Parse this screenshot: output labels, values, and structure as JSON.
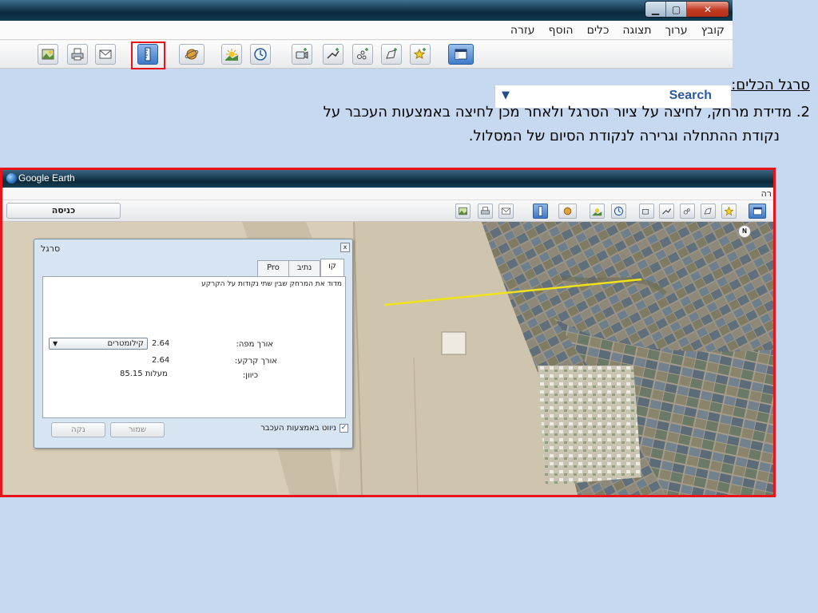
{
  "window_controls": {
    "minimize": "▁",
    "maximize": "▢",
    "close": "✕"
  },
  "menubar": {
    "items": [
      "קובץ",
      "ערוך",
      "תצוגה",
      "כלים",
      "הוסף",
      "עזרה"
    ]
  },
  "toolbar": {
    "buttons": [
      "image-overlay-icon",
      "print-icon",
      "email-icon",
      "ruler-icon",
      "planet-icon",
      "sunlight-icon",
      "historical-imagery-icon",
      "record-tour-icon",
      "add-path-icon",
      "add-polygon-icon",
      "add-image-icon",
      "add-placemark-icon",
      "sidebar-icon"
    ],
    "selected": "ruler-icon"
  },
  "search": {
    "label": "Search",
    "caret": "▼"
  },
  "instructions": {
    "heading": "סרגל הכלים:",
    "line1": "2. מדידת מרחק, לחיצה על ציור הסרגל ולאחר מכן לחיצה באמצעות העכבר על",
    "line2": "נקודת ההתחלה וגרירה לנקודת הסיום של המסלול."
  },
  "google_earth": {
    "title": "Google Earth",
    "menu_fragment": "רה",
    "enter_button": "כניסה",
    "north_label": "N",
    "accent_line_color": "#f0e21a"
  },
  "ruler_dialog": {
    "title": "סרגל",
    "close": "x",
    "tabs": [
      "קו",
      "נתיב",
      "Pro"
    ],
    "active_tab": "קו",
    "description": "מדוד את המרחק שבין שתי נקודות על הקרקע",
    "map_length_label": "אורך מפה:",
    "map_length_value": "2.64",
    "unit": "קילומטרים",
    "ground_length_label": "אורך קרקע:",
    "ground_length_value": "2.64",
    "heading_label": "כיוון:",
    "heading_value": "85.15 מעלות",
    "checkbox_label": "ניווט באמצעות העכבר",
    "checkbox_checked": "✓",
    "save_button": "שמור",
    "clear_button": "נקה"
  }
}
